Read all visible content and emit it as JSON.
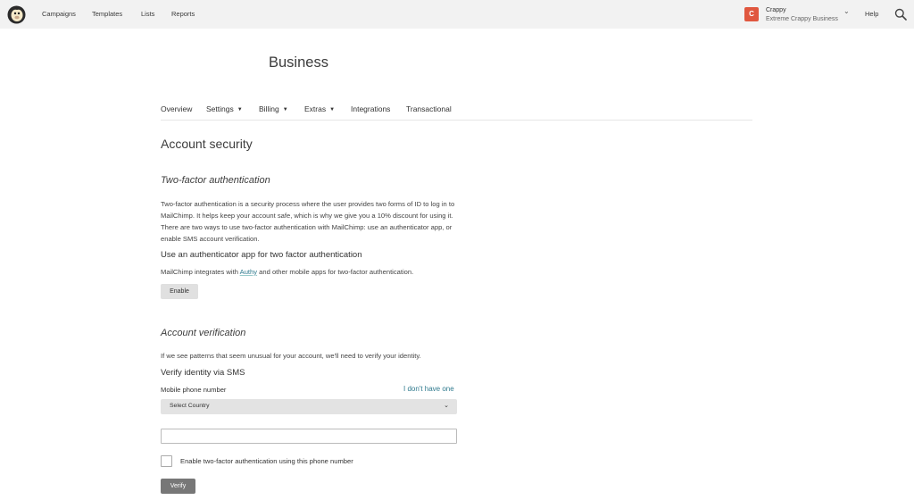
{
  "nav": {
    "campaigns": "Campaigns",
    "templates": "Templates",
    "lists": "Lists",
    "reports": "Reports",
    "help": "Help"
  },
  "account": {
    "initial": "C",
    "name": "Crappy",
    "business": "Extreme Crappy Business",
    "badge_color": "#e0573f"
  },
  "page": {
    "title": "Business"
  },
  "tabs": [
    {
      "label": "Overview"
    },
    {
      "label": "Settings"
    },
    {
      "label": "Billing"
    },
    {
      "label": "Extras"
    },
    {
      "label": "Integrations"
    },
    {
      "label": "Transactional"
    }
  ],
  "security": {
    "title": "Account security",
    "twofa_title": "Two-factor authentication",
    "twofa_desc": "Two-factor authentication is a security process where the user provides two forms of ID to log in to MailChimp. It helps keep your account safe, which is why we give you a 10% discount for using it. There are two ways to use two-factor authentication with MailChimp: use an authenticator app, or enable SMS account verification.",
    "app_heading": "Use an authenticator app for two factor authentication",
    "app_desc_prefix": "MailChimp integrates with ",
    "app_desc_link": "Authy",
    "app_desc_suffix": " and other mobile apps for two-factor authentication.",
    "enable_label": "Enable"
  },
  "verification": {
    "title": "Account verification",
    "desc": "If we see patterns that seem unusual for your account, we'll need to verify your identity.",
    "sms_heading": "Verify identity via SMS",
    "phone_label": "Mobile phone number",
    "no_phone_link": "I don't have one",
    "country_select": "Select Country",
    "phone_value": "",
    "checkbox_label": "Enable two-factor authentication using this phone number",
    "verify_label": "Verify"
  },
  "colors": {
    "link": "#2f7a8e",
    "verify_button": "#777777",
    "topbar": "#f2f2f2"
  }
}
